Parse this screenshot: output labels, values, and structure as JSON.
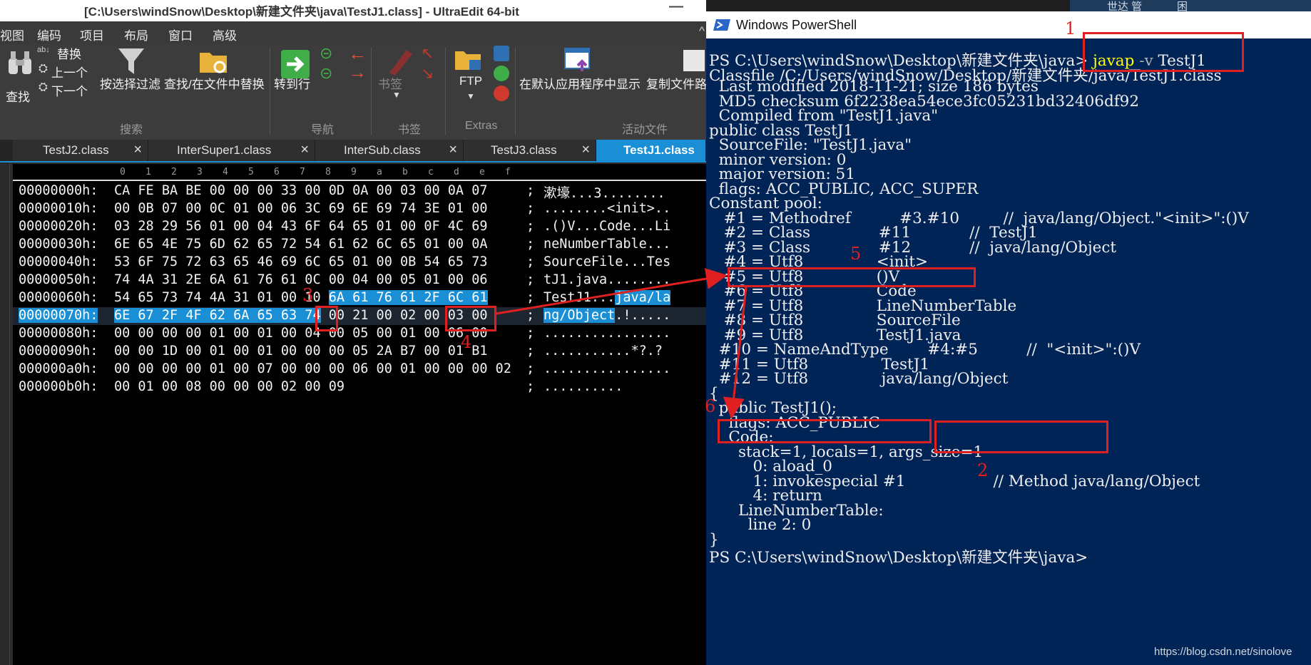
{
  "ultraedit": {
    "title": "[C:\\Users\\windSnow\\Desktop\\新建文件夹\\java\\TestJ1.class] - UltraEdit 64-bit",
    "menu": [
      "视图",
      "编码",
      "项目",
      "布局",
      "窗口",
      "高级"
    ],
    "ribbon": {
      "find": "查找",
      "replace": "替换",
      "prev": "上一个",
      "next": "下一个",
      "filter": "按选择过滤",
      "find_in_files": "查找/在文件中替换",
      "goto_line": "转到行",
      "bookmark": "书签",
      "ftp": "FTP",
      "show_default_app": "在默认应用程序中显示",
      "copy_file_path": "复制文件路",
      "groups": [
        "搜索",
        "导航",
        "书签",
        "Extras",
        "活动文件"
      ]
    },
    "tabs": [
      {
        "name": "TestJ2.class",
        "active": false
      },
      {
        "name": "InterSuper1.class",
        "active": false
      },
      {
        "name": "InterSub.class",
        "active": false
      },
      {
        "name": "TestJ3.class",
        "active": false
      },
      {
        "name": "TestJ1.class",
        "active": true
      }
    ],
    "ruler": [
      "0",
      "1",
      "2",
      "3",
      "4",
      "5",
      "6",
      "7",
      "8",
      "9",
      "a",
      "b",
      "c",
      "d",
      "e",
      "f"
    ],
    "hex_rows": [
      {
        "addr": "00000000h:",
        "bytes": "CA FE BA BE 00 00 00 33 00 0D 0A 00 03 00 0A 07",
        "ascii": "漱壕...3........"
      },
      {
        "addr": "00000010h:",
        "bytes": "00 0B 07 00 0C 01 00 06 3C 69 6E 69 74 3E 01 00",
        "ascii": "........<init>.."
      },
      {
        "addr": "00000020h:",
        "bytes": "03 28 29 56 01 00 04 43 6F 64 65 01 00 0F 4C 69",
        "ascii": ".()V...Code...Li"
      },
      {
        "addr": "00000030h:",
        "bytes": "6E 65 4E 75 6D 62 65 72 54 61 62 6C 65 01 00 0A",
        "ascii": "neNumberTable..."
      },
      {
        "addr": "00000040h:",
        "bytes": "53 6F 75 72 63 65 46 69 6C 65 01 00 0B 54 65 73",
        "ascii": "SourceFile...Tes"
      },
      {
        "addr": "00000050h:",
        "bytes": "74 4A 31 2E 6A 61 76 61 0C 00 04 00 05 01 00 06",
        "ascii": "tJ1.java........"
      },
      {
        "addr": "00000060h:",
        "bytes_plain": "54 65 73 74 4A 31 01 00 10 ",
        "bytes_sel": "6A 61 76 61 2F 6C 61",
        "ascii_plain": "TestJ1...",
        "ascii_sel": "java/la"
      },
      {
        "addr": "00000070h:",
        "bytes_sel": "6E 67 2F 4F 62 6A 65 63 74",
        "bytes_plain": " 00 21 00 02 00 03 00",
        "ascii_sel": "ng/Object",
        "ascii_plain": ".!....."
      },
      {
        "addr": "00000080h:",
        "bytes": "00 00 00 00 01 00 01 00 04 00 05 00 01 00 06 00",
        "ascii": "................"
      },
      {
        "addr": "00000090h:",
        "bytes": "00 00 1D 00 01 00 01 00 00 00 05 2A B7 00 01 B1",
        "ascii": "...........*?.?"
      },
      {
        "addr": "000000a0h:",
        "bytes": "00 00 00 00 01 00 07 00 00 00 06 00 01 00 00 00 02",
        "ascii": "................"
      },
      {
        "addr": "000000b0h:",
        "bytes": "00 01 00 08 00 00 00 02 00 09",
        "ascii": ".........."
      }
    ],
    "ascii_sep": ";"
  },
  "powershell": {
    "title": "Windows PowerShell",
    "prompt": "PS C:\\Users\\windSnow\\Desktop\\新建文件夹\\java>",
    "cmd_name": "javap",
    "cmd_flag": "-v",
    "cmd_arg": "TestJ1",
    "lines": [
      "Classfile /C:/Users/windSnow/Desktop/新建文件夹/java/TestJ1.class",
      "  Last modified 2018-11-21; size 186 bytes",
      "  MD5 checksum 6f2238ea54ece3fc05231bd32406df92",
      "  Compiled from \"TestJ1.java\"",
      "public class TestJ1",
      "  SourceFile: \"TestJ1.java\"",
      "  minor version: 0",
      "  major version: 51",
      "  flags: ACC_PUBLIC, ACC_SUPER",
      "Constant pool:",
      "   #1 = Methodref          #3.#10         //  java/lang/Object.\"<init>\":()V",
      "   #2 = Class              #11            //  TestJ1",
      "   #3 = Class              #12            //  java/lang/Object",
      "   #4 = Utf8               <init>",
      "   #5 = Utf8               ()V",
      "   #6 = Utf8               Code",
      "   #7 = Utf8               LineNumberTable",
      "   #8 = Utf8               SourceFile",
      "   #9 = Utf8               TestJ1.java",
      "  #10 = NameAndType        #4:#5          //  \"<init>\":()V",
      "  #11 = Utf8               TestJ1",
      "  #12 = Utf8               java/lang/Object",
      "{",
      "  public TestJ1();",
      "    flags: ACC_PUBLIC",
      "    Code:",
      "      stack=1, locals=1, args_size=1",
      "         0: aload_0",
      "         1: invokespecial #1                  // Method java/lang/Object",
      "         4: return",
      "      LineNumberTable:",
      "        line 2: 0",
      "}"
    ],
    "final_prompt": "PS C:\\Users\\windSnow\\Desktop\\新建文件夹\\java>"
  },
  "background_window": {
    "items": [
      "世达 管",
      "困"
    ]
  },
  "annotations": [
    "1",
    "2",
    "3",
    "4",
    "5",
    "6"
  ],
  "watermark": "https://blog.csdn.net/sinolove",
  "colors": {
    "selection": "#1a8fd6",
    "ps_background": "#012456",
    "annotation": "#e02020",
    "command": "#ffff00"
  }
}
